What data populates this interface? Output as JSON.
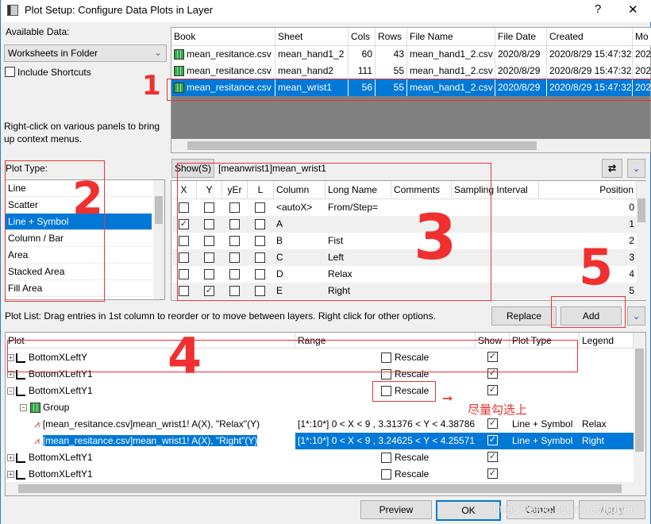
{
  "window": {
    "title": "Plot Setup: Configure Data Plots in Layer",
    "help": "?",
    "close": "✕"
  },
  "available": {
    "label": "Available Data:",
    "dropdown": "Worksheets in Folder",
    "include_shortcuts": "Include Shortcuts",
    "hint": "Right-click on various panels to bring up context menus."
  },
  "books": {
    "headers": [
      "Book",
      "Sheet",
      "Cols",
      "Rows",
      "File Name",
      "File Date",
      "Created",
      "Mo"
    ],
    "rows": [
      [
        "mean_resitance.csv",
        "mean_hand1_2",
        "60",
        "43",
        "mean_hand1_2.csv",
        "2020/8/29",
        "2020/8/29 15:47:32",
        "202"
      ],
      [
        "mean_resitance.csv",
        "mean_hand2",
        "111",
        "55",
        "mean_hand1_2.csv",
        "2020/8/29",
        "2020/8/29 15:47:32",
        "202"
      ],
      [
        "mean_resitance.csv",
        "mean_wrist1",
        "56",
        "55",
        "mean_hand1_2.csv",
        "2020/8/29",
        "2020/8/29 15:47:32",
        "202"
      ]
    ],
    "selected": 2
  },
  "plot_type": {
    "label": "Plot Type:",
    "items": [
      "Line",
      "Scatter",
      "Line + Symbol",
      "Column / Bar",
      "Area",
      "Stacked Area",
      "Fill Area"
    ],
    "selected": 2
  },
  "columns": {
    "show_button": "Show(S)",
    "sheet": "[meanwrist1]mean_wrist1",
    "headers": [
      "X",
      "Y",
      "yEr",
      "L",
      "Column",
      "Long Name",
      "Comments",
      "Sampling Interval",
      "Position"
    ],
    "rows": [
      {
        "x": false,
        "y": false,
        "col": "<autoX>",
        "long": "From/Step=",
        "pos": "0"
      },
      {
        "x": true,
        "y": false,
        "col": "A",
        "long": "",
        "pos": "1"
      },
      {
        "x": false,
        "y": false,
        "col": "B",
        "long": "Fist",
        "pos": "2"
      },
      {
        "x": false,
        "y": false,
        "col": "C",
        "long": "Left",
        "pos": "3"
      },
      {
        "x": false,
        "y": false,
        "col": "D",
        "long": "Relax",
        "pos": "4"
      },
      {
        "x": false,
        "y": true,
        "col": "E",
        "long": "Right",
        "pos": "5"
      }
    ]
  },
  "plot_list": {
    "hint": "Plot List: Drag entries in 1st column to reorder or to move between layers. Right click for other options.",
    "replace": "Replace",
    "add": "Add",
    "headers": [
      "Plot",
      "Range",
      "Show",
      "Plot Type",
      "Legend"
    ],
    "rows": [
      {
        "kind": "layer",
        "exp": "+",
        "label": "BottomXLeftY",
        "rescale": "Rescale",
        "show": true
      },
      {
        "kind": "layer",
        "exp": "+",
        "label": "BottomXLeftY1",
        "rescale": "Rescale",
        "show": true
      },
      {
        "kind": "layer",
        "exp": "−",
        "label": "BottomXLeftY1",
        "rescale": "Rescale",
        "show": true
      },
      {
        "kind": "group",
        "exp": "−",
        "label": "Group"
      },
      {
        "kind": "plot",
        "label": "[mean_resitance.csv]mean_wrist1! A(X), \"Relax\"(Y)",
        "range": "[1*:10*]  0 < X < 9 , 3.31376 < Y < 4.38786",
        "show": true,
        "type": "Line + Symbol",
        "legend": "Relax"
      },
      {
        "kind": "plot",
        "label": "[mean_resitance.csv]mean_wrist1! A(X), \"Right\"(Y)",
        "range": "[1*:10*]  0 < X < 9 , 3.24625 < Y < 4.25571",
        "show": true,
        "type": "Line + Symbol",
        "legend": "Right",
        "selected": true
      },
      {
        "kind": "layer",
        "exp": "+",
        "label": "BottomXLeftY1",
        "rescale": "Rescale",
        "show": true
      },
      {
        "kind": "layer",
        "exp": "+",
        "label": "BottomXLeftY1",
        "rescale": "Rescale",
        "show": true
      }
    ]
  },
  "footer": {
    "preview": "Preview",
    "ok": "OK",
    "cancel": "Cancel",
    "apply": "Apply",
    "watermark": "https://blog.csdn.net/frober"
  },
  "annotations": {
    "n1": "1",
    "n2": "2",
    "n3": "3",
    "n4": "4",
    "n5": "5",
    "note": "尽量勾选上",
    "color": "#f03030"
  }
}
